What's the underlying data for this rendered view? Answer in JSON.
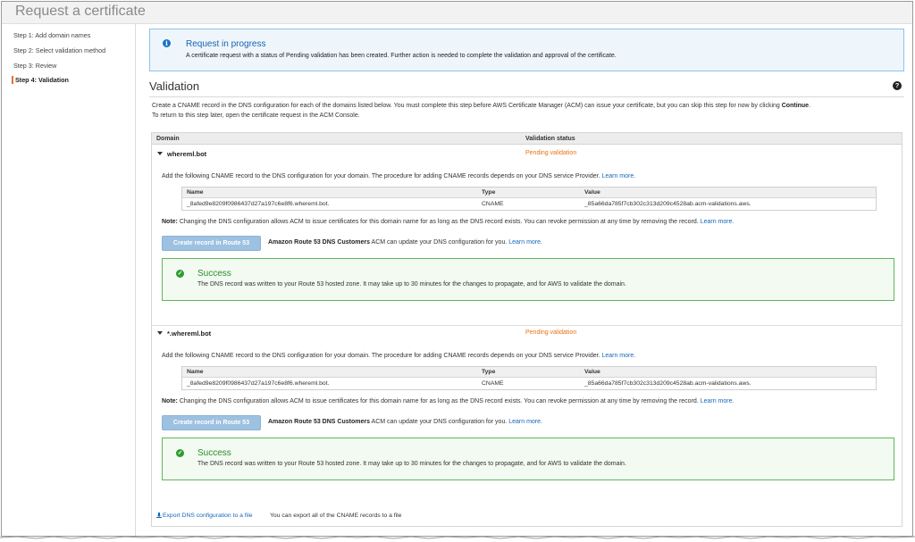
{
  "page": {
    "title": "Request a certificate"
  },
  "sidebar": {
    "steps": [
      {
        "label": "Step 1: Add domain names"
      },
      {
        "label": "Step 2: Select validation method"
      },
      {
        "label": "Step 3: Review"
      },
      {
        "label": "Step 4: Validation"
      }
    ],
    "active_index": 3
  },
  "info_alert": {
    "icon": "info-icon",
    "title": "Request in progress",
    "text": "A certificate request with a status of Pending validation has been created. Further action is needed to complete the validation and approval of the certificate."
  },
  "validation": {
    "title": "Validation",
    "help_icon": "question-circle-icon",
    "desc_line1": "Create a CNAME record in the DNS configuration for each of the domains listed below. You must complete this step before AWS Certificate Manager (ACM) can issue your certificate, but you can skip this step for now by clicking",
    "desc_continue": "Continue",
    "desc_line2": "To return to this step later, open the certificate request in the ACM Console.",
    "columns": {
      "domain": "Domain",
      "status": "Validation status"
    }
  },
  "domains": [
    {
      "name": "whereml.bot",
      "status": "Pending validation",
      "instructions": "Add the following CNAME record to the DNS configuration for your domain. The procedure for adding CNAME records depends on your DNS service Provider.",
      "learn_more": "Learn more.",
      "record_headers": {
        "name": "Name",
        "type": "Type",
        "value": "Value"
      },
      "record": {
        "name": "_8afed9e8209f0986437d27a197c6e8f6.whereml.bot.",
        "type": "CNAME",
        "value": "_85a66da785f7cb302c313d209c4528ab.acm-validations.aws."
      },
      "note_label": "Note:",
      "note_text": "Changing the DNS configuration allows ACM to issue certificates for this domain name for as long as the DNS record exists. You can revoke permission at any time by removing the record.",
      "note_learn_more": "Learn more.",
      "button_label": "Create record in Route 53",
      "route53_bold": "Amazon Route 53 DNS Customers",
      "route53_text": "ACM can update your DNS configuration for you.",
      "route53_learn_more": "Learn more.",
      "success": {
        "icon": "check-circle-icon",
        "title": "Success",
        "text": "The DNS record was written to your Route 53 hosted zone. It may take up to 30 minutes for the changes to propagate, and for AWS to validate the domain."
      }
    },
    {
      "name": "*.whereml.bot",
      "status": "Pending validation",
      "instructions": "Add the following CNAME record to the DNS configuration for your domain. The procedure for adding CNAME records depends on your DNS service Provider.",
      "learn_more": "Learn more.",
      "record_headers": {
        "name": "Name",
        "type": "Type",
        "value": "Value"
      },
      "record": {
        "name": "_8afed9e8209f0986437d27a197c6e8f6.whereml.bot.",
        "type": "CNAME",
        "value": "_85a66da785f7cb302c313d209c4528ab.acm-validations.aws."
      },
      "note_label": "Note:",
      "note_text": "Changing the DNS configuration allows ACM to issue certificates for this domain name for as long as the DNS record exists. You can revoke permission at any time by removing the record.",
      "note_learn_more": "Learn more.",
      "button_label": "Create record in Route 53",
      "route53_bold": "Amazon Route 53 DNS Customers",
      "route53_text": "ACM can update your DNS configuration for you.",
      "route53_learn_more": "Learn more.",
      "success": {
        "icon": "check-circle-icon",
        "title": "Success",
        "text": "The DNS record was written to your Route 53 hosted zone. It may take up to 30 minutes for the changes to propagate, and for AWS to validate the domain."
      }
    }
  ],
  "export": {
    "icon": "download-icon",
    "link": "Export DNS configuration to a file",
    "note": "You can export all of the CNAME records to a file"
  },
  "colors": {
    "accent_orange": "#ec7211",
    "link_blue": "#1466b8",
    "info_border": "#8fc1e8",
    "success_green": "#2e9b33",
    "button_disabled": "#9dc1e0"
  }
}
